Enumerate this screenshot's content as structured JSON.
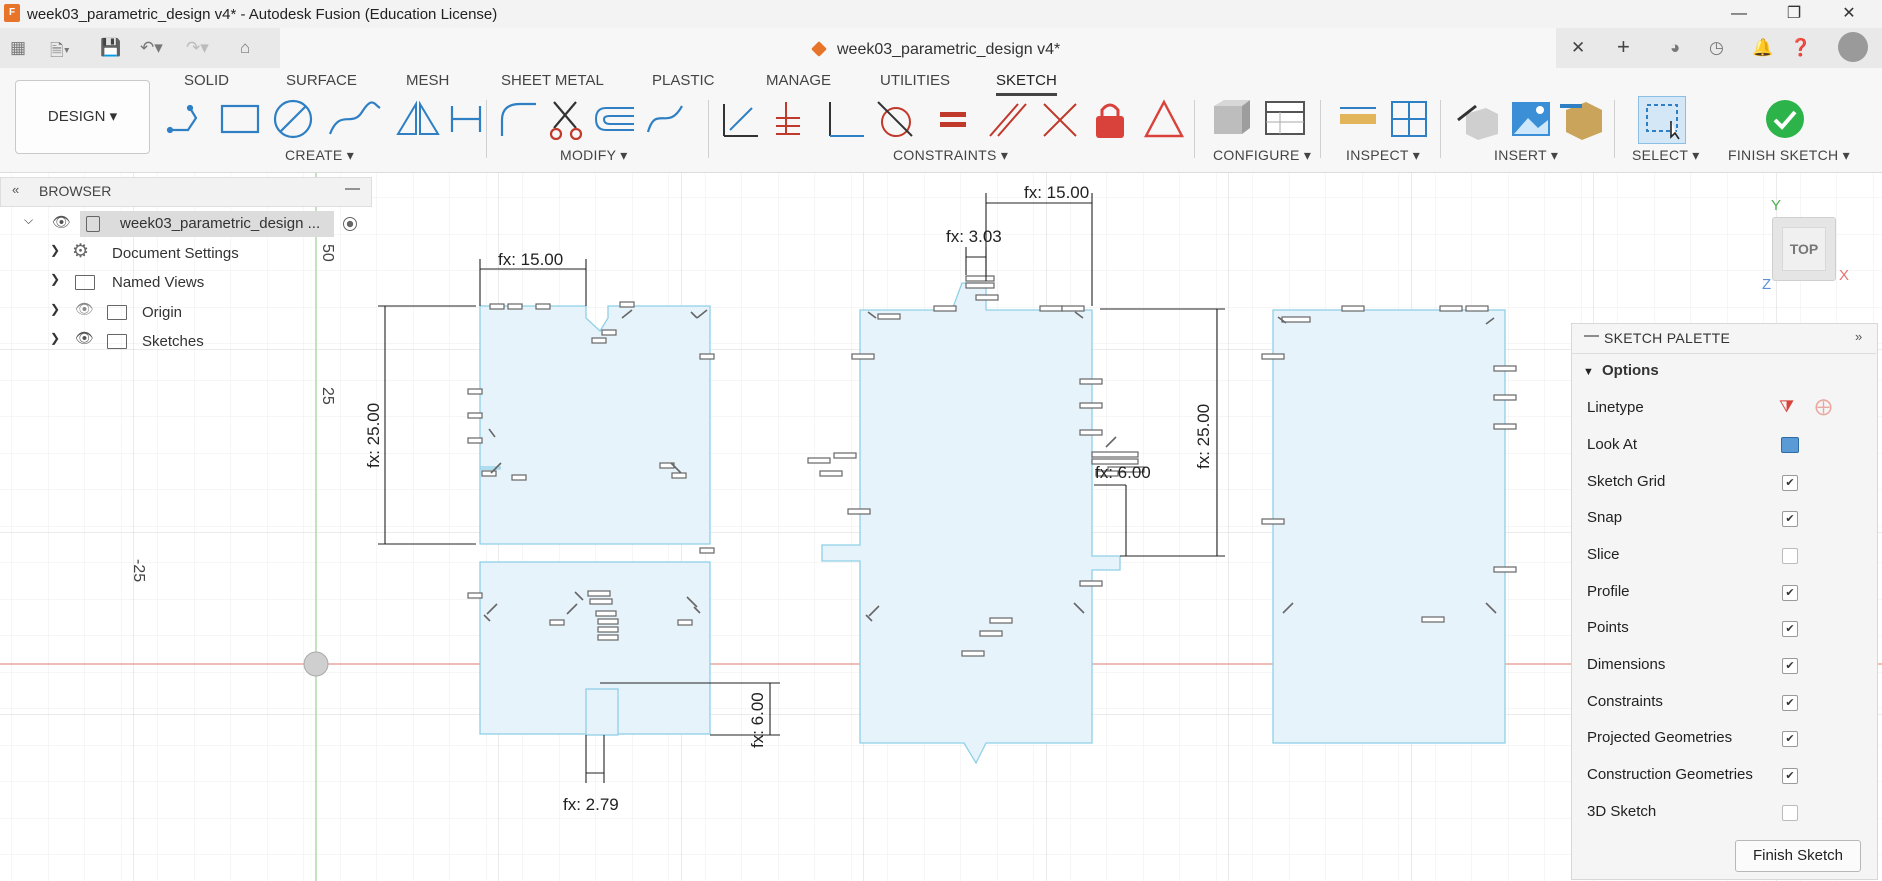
{
  "window": {
    "title": "week03_parametric_design v4* - Autodesk Fusion (Education License)",
    "app_icon": "F",
    "controls": [
      "minimize-icon",
      "maximize-icon",
      "close-icon"
    ]
  },
  "document_tab": {
    "title": "week03_parametric_design v4*"
  },
  "toolbar": {
    "workspace": "DESIGN",
    "tabs": [
      "SOLID",
      "SURFACE",
      "MESH",
      "SHEET METAL",
      "PLASTIC",
      "MANAGE",
      "UTILITIES",
      "SKETCH"
    ],
    "active_tab": "SKETCH",
    "groups": {
      "create": "CREATE",
      "modify": "MODIFY",
      "constraints": "CONSTRAINTS",
      "configure": "CONFIGURE",
      "inspect": "INSPECT",
      "insert": "INSERT",
      "select": "SELECT",
      "finish": "FINISH SKETCH"
    }
  },
  "browser": {
    "header": "BROWSER",
    "root": "week03_parametric_design ...",
    "items": [
      {
        "label": "Document Settings",
        "icon": "gear-icon"
      },
      {
        "label": "Named Views",
        "icon": "folder-icon"
      },
      {
        "label": "Origin",
        "icon": "folder-icon"
      },
      {
        "label": "Sketches",
        "icon": "folder-icon"
      }
    ]
  },
  "canvas": {
    "grid_labels": [
      "50",
      "25",
      "-25"
    ],
    "dimensions": {
      "left_width": "fx: 15.00",
      "left_height": "fx: 25.00",
      "left_slot_depth": "fx: 6.00",
      "left_slot_width": "fx: 2.79",
      "mid_width": "fx: 15.00",
      "mid_notch": "fx: 3.03",
      "mid_slot": "fx: 6.00",
      "mid_height": "fx: 25.00"
    },
    "viewcube": {
      "face": "TOP",
      "axis_y": "Y",
      "axis_x": "X",
      "axis_z": "Z"
    }
  },
  "palette": {
    "title": "SKETCH PALETTE",
    "section": "Options",
    "rows": [
      {
        "label": "Linetype",
        "type": "icon"
      },
      {
        "label": "Look At",
        "type": "icon"
      },
      {
        "label": "Sketch Grid",
        "checked": true
      },
      {
        "label": "Snap",
        "checked": true
      },
      {
        "label": "Slice",
        "checked": false
      },
      {
        "label": "Profile",
        "checked": true
      },
      {
        "label": "Points",
        "checked": true
      },
      {
        "label": "Dimensions",
        "checked": true
      },
      {
        "label": "Constraints",
        "checked": true
      },
      {
        "label": "Projected Geometries",
        "checked": true
      },
      {
        "label": "Construction Geometries",
        "checked": true
      },
      {
        "label": "3D Sketch",
        "checked": false
      }
    ],
    "finish_button": "Finish Sketch"
  },
  "colors": {
    "sketch_fill": "#e7f3fb",
    "sketch_line": "#8fd0e6",
    "x_axis": "#e9a7a0",
    "y_axis": "#a8d8a0",
    "accent_green": "#2cb34a",
    "red_constraint": "#d9413b"
  }
}
